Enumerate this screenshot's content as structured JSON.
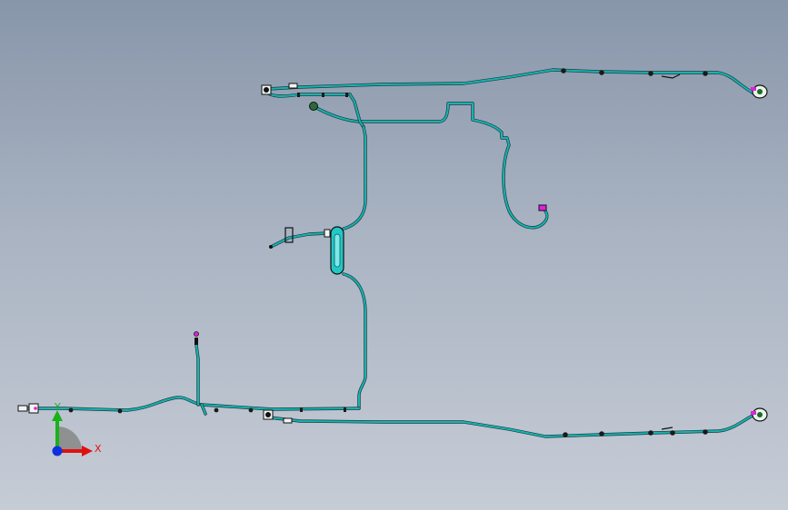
{
  "triad": {
    "x_label": "X",
    "y_label": "Y",
    "x_color": "#e01010",
    "y_color": "#19b219",
    "z_color": "#1030e0"
  },
  "model": {
    "harness_color": "#00a8a8",
    "outline_color": "#1a2a2a",
    "connector_accent": "#e020e0"
  }
}
